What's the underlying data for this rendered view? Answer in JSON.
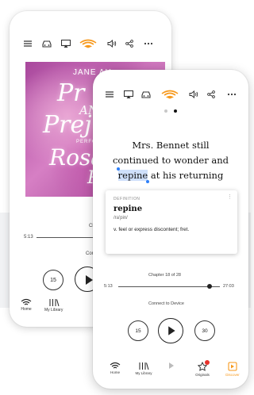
{
  "colors": {
    "accent": "#f7991c",
    "highlight": "#cfe0fb",
    "selection_handle": "#2d7ff9",
    "badge": "#e8322b",
    "backdrop_band": "#f1f2f4"
  },
  "back_screen": {
    "toolbar_icons": [
      "menu-icon",
      "car-mode-icon",
      "airplay-icon",
      "audible-logo-icon",
      "volume-icon",
      "share-icon",
      "more-icon"
    ],
    "cover": {
      "author": "JANE AU",
      "title_line1": "Pr",
      "title_and": "AN",
      "title_line2": "Prej",
      "narrator_prefix": "PERFOR",
      "narrator_line1": "Rosan",
      "narrator_line2": "Pi"
    },
    "chapter": "Chapter 1",
    "elapsed": "5:13",
    "connect": "Connect to",
    "skip_back": "15",
    "nav": [
      {
        "icon": "home-icon",
        "label": "Home"
      },
      {
        "icon": "library-icon",
        "label": "My Library"
      }
    ]
  },
  "front_screen": {
    "toolbar_icons": [
      "menu-icon",
      "airplay-icon",
      "car-mode-icon",
      "audible-logo-icon",
      "volume-icon",
      "share-icon",
      "more-icon"
    ],
    "page_dots": 2,
    "active_dot": 1,
    "reader_text": {
      "line1": "Mrs. Bennet still",
      "line2": "continued to wonder and",
      "selected_word": "repine",
      "line3_rest": " at his returning"
    },
    "definition": {
      "caption": "DEFINITION",
      "word": "repine",
      "pronunciation": "/ra'pin/",
      "meaning": "v. feel or express discontent; fret."
    },
    "chapter": "Chapter 18 of 28",
    "elapsed": "5:13",
    "remaining": "27:03",
    "progress": 0.9,
    "connect": "Connect to Device",
    "skip_back": "15",
    "skip_forward": "30",
    "nav": [
      {
        "icon": "home-icon",
        "label": "Home"
      },
      {
        "icon": "library-icon",
        "label": "My Library"
      },
      {
        "icon": "player-icon",
        "label": ""
      },
      {
        "icon": "originals-star-icon",
        "label": "Originals"
      },
      {
        "icon": "discover-icon",
        "label": "Discover"
      }
    ]
  }
}
